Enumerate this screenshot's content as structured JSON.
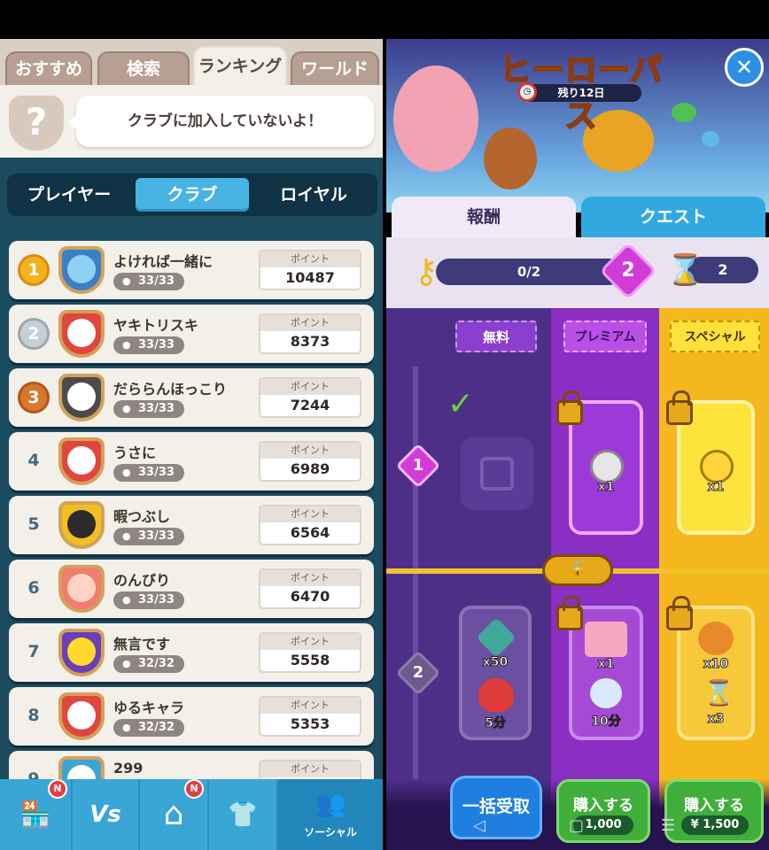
{
  "left": {
    "tabs": [
      {
        "label": "おすすめ",
        "active": false
      },
      {
        "label": "検索",
        "active": false
      },
      {
        "label": "ランキング",
        "active": true
      },
      {
        "label": "ワールド",
        "active": false
      }
    ],
    "club_notice": "クラブに加入していないよ！",
    "segments": [
      {
        "label": "プレイヤー",
        "active": false
      },
      {
        "label": "クラブ",
        "active": true
      },
      {
        "label": "ロイヤル",
        "active": false
      }
    ],
    "points_label": "ポイント",
    "rows": [
      {
        "rank": "1",
        "medal": "gold",
        "name": "よければ一緒に",
        "members": "33/33",
        "points": "10487",
        "shield_color": "#3a7fc8",
        "emblem_color": "#8fd0f4"
      },
      {
        "rank": "2",
        "medal": "silver",
        "name": "ヤキトリスキ",
        "members": "33/33",
        "points": "8373",
        "shield_color": "#e0463c",
        "emblem_color": "#ffffff"
      },
      {
        "rank": "3",
        "medal": "bronze",
        "name": "だららんほっこり",
        "members": "33/33",
        "points": "7244",
        "shield_color": "#4b4b4b",
        "emblem_color": "#ffffff"
      },
      {
        "rank": "4",
        "medal": "plain",
        "name": "うさに",
        "members": "33/33",
        "points": "6989",
        "shield_color": "#e0463c",
        "emblem_color": "#ffffff"
      },
      {
        "rank": "5",
        "medal": "plain",
        "name": "暇つぶし",
        "members": "33/33",
        "points": "6564",
        "shield_color": "#f2bf1f",
        "emblem_color": "#2b2b2b"
      },
      {
        "rank": "6",
        "medal": "plain",
        "name": "のんびり",
        "members": "33/33",
        "points": "6470",
        "shield_color": "#f07d6e",
        "emblem_color": "#ffd3c8"
      },
      {
        "rank": "7",
        "medal": "plain",
        "name": "無言です",
        "members": "32/32",
        "points": "5558",
        "shield_color": "#6a3fb8",
        "emblem_color": "#ffd92e"
      },
      {
        "rank": "8",
        "medal": "plain",
        "name": "ゆるキャラ",
        "members": "32/32",
        "points": "5353",
        "shield_color": "#e0463c",
        "emblem_color": "#ffffff"
      },
      {
        "rank": "9",
        "medal": "plain",
        "name": "299",
        "members": "",
        "points": "",
        "shield_color": "#3aa6d6",
        "emblem_color": "#ffffff"
      }
    ],
    "nav": [
      {
        "icon": "shop-icon",
        "glyph": "🏪",
        "badge": "N",
        "label": ""
      },
      {
        "icon": "versus-icon",
        "glyph": "Vs",
        "badge": "",
        "label": ""
      },
      {
        "icon": "home-icon",
        "glyph": "⌂",
        "badge": "N",
        "label": ""
      },
      {
        "icon": "shirt-icon",
        "glyph": "👕",
        "badge": "",
        "label": ""
      },
      {
        "icon": "social-icon",
        "glyph": "👥",
        "badge": "",
        "label": "ソーシャル"
      }
    ]
  },
  "right": {
    "title": "ヒーローパス",
    "remaining": "残り12日",
    "tabs": [
      {
        "label": "報酬",
        "active": true
      },
      {
        "label": "クエスト",
        "active": false
      }
    ],
    "progress_text": "0/2",
    "level_badge": "2",
    "hourglass_count": "2",
    "columns": {
      "free": "無料",
      "premium": "プレミアム",
      "special": "スペシャル"
    },
    "levels": [
      {
        "level": "1",
        "free_claimed_mark": "✓",
        "premium_qty": "x1",
        "special_qty": "x1"
      },
      {
        "level": "2",
        "free": [
          {
            "qty": "x50"
          },
          {
            "qty": "5分"
          }
        ],
        "premium": [
          {
            "qty": "x1"
          },
          {
            "qty": "10分"
          }
        ],
        "special": [
          {
            "qty": "x10"
          },
          {
            "qty": "x3"
          }
        ]
      }
    ],
    "bottom": {
      "claim_all": "一括受取",
      "buy_label": "購入する",
      "premium_price": "1,000",
      "special_price": "¥ 1,500"
    },
    "colors": {
      "free_col": "#4e2f88",
      "premium_col": "#8a2ec4",
      "special_col": "#f4b81e",
      "gold_line": "#f2c22d"
    }
  }
}
